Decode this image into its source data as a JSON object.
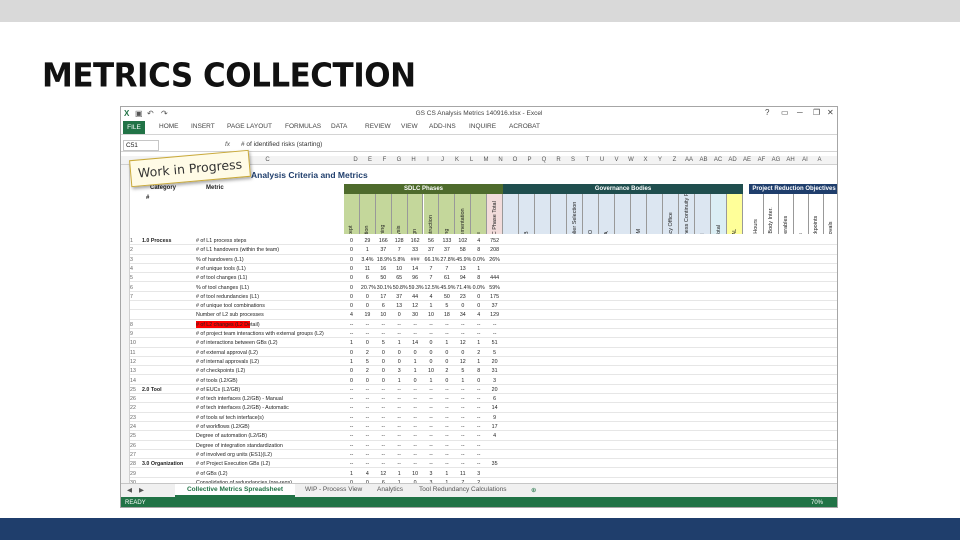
{
  "slide": {
    "title": "METRICS COLLECTION"
  },
  "sticky": {
    "text": "Work in Progress"
  },
  "excel": {
    "doc_title": "GS CS Analysis Metrics 140916.xlsx - Excel",
    "window_controls": [
      "?",
      "─",
      "✕"
    ],
    "ribbon_tabs": [
      "FILE",
      "HOME",
      "INSERT",
      "PAGE LAYOUT",
      "FORMULAS",
      "DATA",
      "REVIEW",
      "VIEW",
      "ADD-INS",
      "INQUIRE",
      "ACROBAT"
    ],
    "name_box": "C51",
    "fx": "fx",
    "formula": "# of identified risks (starting)",
    "columns": [
      "C",
      "D",
      "E",
      "F",
      "G",
      "H",
      "I",
      "J",
      "K",
      "L",
      "M",
      "N",
      "O",
      "P",
      "Q",
      "R",
      "S",
      "T",
      "U",
      "V",
      "W",
      "X",
      "Y",
      "Z",
      "AA",
      "AB",
      "AC",
      "AD",
      "AE",
      "AF",
      "AG",
      "AH",
      "AI",
      "A"
    ],
    "sheet_title": "Analysis Criteria and Metrics",
    "headers": {
      "category": "Category",
      "metric": "Metric",
      "num": "#"
    },
    "bands": {
      "sdlc": "SDLC Phases",
      "gov": "Governance Bodies",
      "proj": "Project Reduction Objectives"
    },
    "sdlc_cols": [
      "Concept",
      "Initiation",
      "Planning",
      "Analysis",
      "Design",
      "Construction",
      "Testing",
      "Implementation",
      "Close",
      "SDLC Phase Total"
    ],
    "gov_cols": [
      "EDG",
      "ESAB",
      "SSA",
      "PDO",
      "Supplier Selection",
      "EPMO",
      "FRSA",
      "TSP",
      "PMOM",
      "ARB",
      "Privacy Office",
      "Business Continuity Plan",
      "CRM",
      "GB Total",
      "TOTAL"
    ],
    "proj_cols": [
      "Man Hours",
      "Dev. Body Inter.",
      "Deliverables",
      "Tools",
      "Checkpoints",
      "Approvals"
    ],
    "rows": [
      {
        "n": "1",
        "cat": "1.0 Process",
        "metric": "# of L1 process steps",
        "vals": [
          "0",
          "29",
          "166",
          "128",
          "162",
          "56",
          "133",
          "102",
          "4",
          "752"
        ]
      },
      {
        "n": "2",
        "cat": "",
        "metric": "# of L1 handovers (within the team)",
        "vals": [
          "0",
          "1",
          "37",
          "7",
          "33",
          "37",
          "37",
          "58",
          "8",
          "208"
        ]
      },
      {
        "n": "3",
        "cat": "",
        "metric": "% of handovers (L1)",
        "vals": [
          "0",
          "3.4%",
          "18.9%",
          "5.8%",
          "###",
          "66.1%",
          "27.8%",
          "45.9%",
          "0.0%",
          "26%"
        ]
      },
      {
        "n": "4",
        "cat": "",
        "metric": "# of unique tools (L1)",
        "vals": [
          "0",
          "11",
          "16",
          "10",
          "14",
          "7",
          "7",
          "13",
          "1",
          ""
        ]
      },
      {
        "n": "5",
        "cat": "",
        "metric": "# of tool changes (L1)",
        "vals": [
          "0",
          "6",
          "50",
          "65",
          "96",
          "7",
          "61",
          "94",
          "8",
          "444"
        ]
      },
      {
        "n": "6",
        "cat": "",
        "metric": "% of tool changes (L1)",
        "vals": [
          "0",
          "20.7%",
          "30.1%",
          "50.8%",
          "59.3%",
          "12.5%",
          "45.9%",
          "71.4%",
          "0.0%",
          "59%"
        ]
      },
      {
        "n": "7",
        "cat": "",
        "metric": "# of tool redundancies (L1)",
        "vals": [
          "0",
          "0",
          "17",
          "37",
          "44",
          "4",
          "50",
          "23",
          "0",
          "175"
        ]
      },
      {
        "n": "",
        "cat": "",
        "metric": "# of unique tool combinations",
        "vals": [
          "0",
          "0",
          "6",
          "13",
          "12",
          "1",
          "5",
          "0",
          "0",
          "37"
        ]
      },
      {
        "n": "",
        "cat": "",
        "metric": "Number of L2 sub processes",
        "vals": [
          "4",
          "19",
          "10",
          "0",
          "30",
          "10",
          "18",
          "34",
          "4",
          "129"
        ]
      },
      {
        "n": "8",
        "cat": "",
        "metric": "# of L2 changes (L2 Detail)",
        "vals": [
          "--",
          "--",
          "--",
          "--",
          "--",
          "--",
          "--",
          "--",
          "--",
          "--"
        ]
      },
      {
        "n": "9",
        "cat": "",
        "metric": "# of project team interactions with external groups (L2)",
        "vals": [
          "--",
          "--",
          "--",
          "--",
          "--",
          "--",
          "--",
          "--",
          "--",
          "--"
        ]
      },
      {
        "n": "10",
        "cat": "",
        "metric": "# of interactions between GBs (L2)",
        "vals": [
          "1",
          "0",
          "5",
          "1",
          "14",
          "0",
          "1",
          "12",
          "1",
          "51"
        ]
      },
      {
        "n": "11",
        "cat": "",
        "metric": "# of external approval (L2)",
        "vals": [
          "0",
          "2",
          "0",
          "0",
          "0",
          "0",
          "0",
          "0",
          "2",
          "5"
        ]
      },
      {
        "n": "12",
        "cat": "",
        "metric": "# of internal approvals (L2)",
        "vals": [
          "1",
          "5",
          "0",
          "0",
          "1",
          "0",
          "0",
          "12",
          "1",
          "20"
        ]
      },
      {
        "n": "13",
        "cat": "",
        "metric": "# of checkpoints (L2)",
        "vals": [
          "0",
          "2",
          "0",
          "3",
          "1",
          "10",
          "2",
          "5",
          "8",
          "31"
        ]
      },
      {
        "n": "14",
        "cat": "",
        "metric": "# of tools (L2/GB)",
        "vals": [
          "0",
          "0",
          "0",
          "1",
          "0",
          "1",
          "0",
          "1",
          "0",
          "3"
        ]
      },
      {
        "n": "25",
        "cat": "2.0 Tool",
        "metric": "# of EUCs (L2/GB)",
        "vals": [
          "--",
          "--",
          "--",
          "--",
          "--",
          "--",
          "--",
          "--",
          "--",
          "20"
        ]
      },
      {
        "n": "26",
        "cat": "",
        "metric": "# of tech interfaces (L2/GB) - Manual",
        "vals": [
          "--",
          "--",
          "--",
          "--",
          "--",
          "--",
          "--",
          "--",
          "--",
          "6"
        ]
      },
      {
        "n": "22",
        "cat": "",
        "metric": "# of tech interfaces (L2/GB) - Automatic",
        "vals": [
          "--",
          "--",
          "--",
          "--",
          "--",
          "--",
          "--",
          "--",
          "--",
          "14"
        ]
      },
      {
        "n": "23",
        "cat": "",
        "metric": "# of tools w/ tech interface(s)",
        "vals": [
          "--",
          "--",
          "--",
          "--",
          "--",
          "--",
          "--",
          "--",
          "--",
          "9"
        ]
      },
      {
        "n": "24",
        "cat": "",
        "metric": "# of workflows (L2/GB)",
        "vals": [
          "--",
          "--",
          "--",
          "--",
          "--",
          "--",
          "--",
          "--",
          "--",
          "17"
        ]
      },
      {
        "n": "25",
        "cat": "",
        "metric": "Degree of automation (L2/GB)",
        "vals": [
          "--",
          "--",
          "--",
          "--",
          "--",
          "--",
          "--",
          "--",
          "--",
          "4"
        ]
      },
      {
        "n": "26",
        "cat": "",
        "metric": "Degree of integration standardization",
        "vals": [
          "--",
          "--",
          "--",
          "--",
          "--",
          "--",
          "--",
          "--",
          "--",
          ""
        ]
      },
      {
        "n": "27",
        "cat": "",
        "metric": "# of involved org units (ES1)(L2)",
        "vals": [
          "--",
          "--",
          "--",
          "--",
          "--",
          "--",
          "--",
          "--",
          "--",
          ""
        ]
      },
      {
        "n": "28",
        "cat": "3.0 Organization",
        "metric": "# of Project Execution GBs (L2)",
        "vals": [
          "--",
          "--",
          "--",
          "--",
          "--",
          "--",
          "--",
          "--",
          "--",
          "35"
        ]
      },
      {
        "n": "29",
        "cat": "",
        "metric": "# of GBs (L2)",
        "vals": [
          "1",
          "4",
          "12",
          "1",
          "10",
          "3",
          "1",
          "11",
          "3",
          ""
        ]
      },
      {
        "n": "30",
        "cat": "",
        "metric": "Consolidation of redundancies (pre-reqs)",
        "vals": [
          "0",
          "0",
          "6",
          "1",
          "0",
          "3",
          "1",
          "7",
          "2",
          ""
        ]
      }
    ],
    "sheet_tabs": [
      "Collective Metrics Spreadsheet",
      "WIP - Process View",
      "Analytics",
      "Tool Redundancy Calculations"
    ],
    "status": "READY",
    "zoom": "70%"
  }
}
